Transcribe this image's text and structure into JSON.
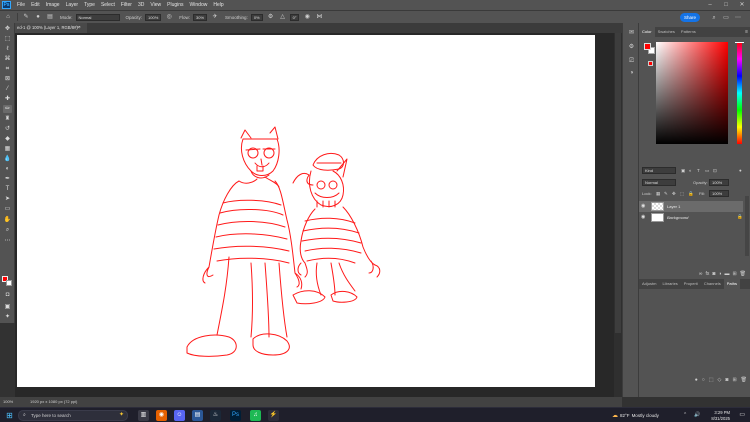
{
  "app": {
    "logo": "Ps"
  },
  "menubar": {
    "items": [
      "File",
      "Edit",
      "Image",
      "Layer",
      "Type",
      "Select",
      "Filter",
      "3D",
      "View",
      "Plugins",
      "Window",
      "Help"
    ]
  },
  "options": {
    "mode_label": "Mode:",
    "mode_value": "Normal",
    "opacity_label": "Opacity:",
    "opacity_value": "100%",
    "flow_label": "Flow:",
    "flow_value": "30%",
    "smoothing_label": "Smoothing:",
    "smoothing_value": "0%",
    "angle_value": "0°",
    "share_label": "Share"
  },
  "document": {
    "tab_title": "ed-1 @ 100% (Layer 1, RGB/8#) *",
    "zoom": "100%",
    "doc_size": "1920 px x 1080 px (72 ppi)"
  },
  "panels": {
    "color_tabs": [
      "Color",
      "Swatches",
      "Patterns"
    ],
    "color": {
      "foreground": "#ff0000",
      "background": "#ffffff"
    },
    "layers_tab": "Layers",
    "kind_value": "Kind",
    "blend_mode": "Normal",
    "opacity_label": "Opacity:",
    "opacity_value": "100%",
    "lock_label": "Lock:",
    "fill_label": "Fill:",
    "fill_value": "100%",
    "layers": [
      {
        "name": "Layer 1",
        "selected": true
      },
      {
        "name": "Background",
        "selected": false
      }
    ],
    "bottom_tabs": [
      "Adjustm",
      "Libraries",
      "Properti",
      "Channels",
      "Paths"
    ]
  },
  "taskbar": {
    "search_placeholder": "Type here to search",
    "weather_temp": "82°F",
    "weather_desc": "Mostly cloudy",
    "time": "3:29 PM",
    "date": "8/31/2025"
  }
}
